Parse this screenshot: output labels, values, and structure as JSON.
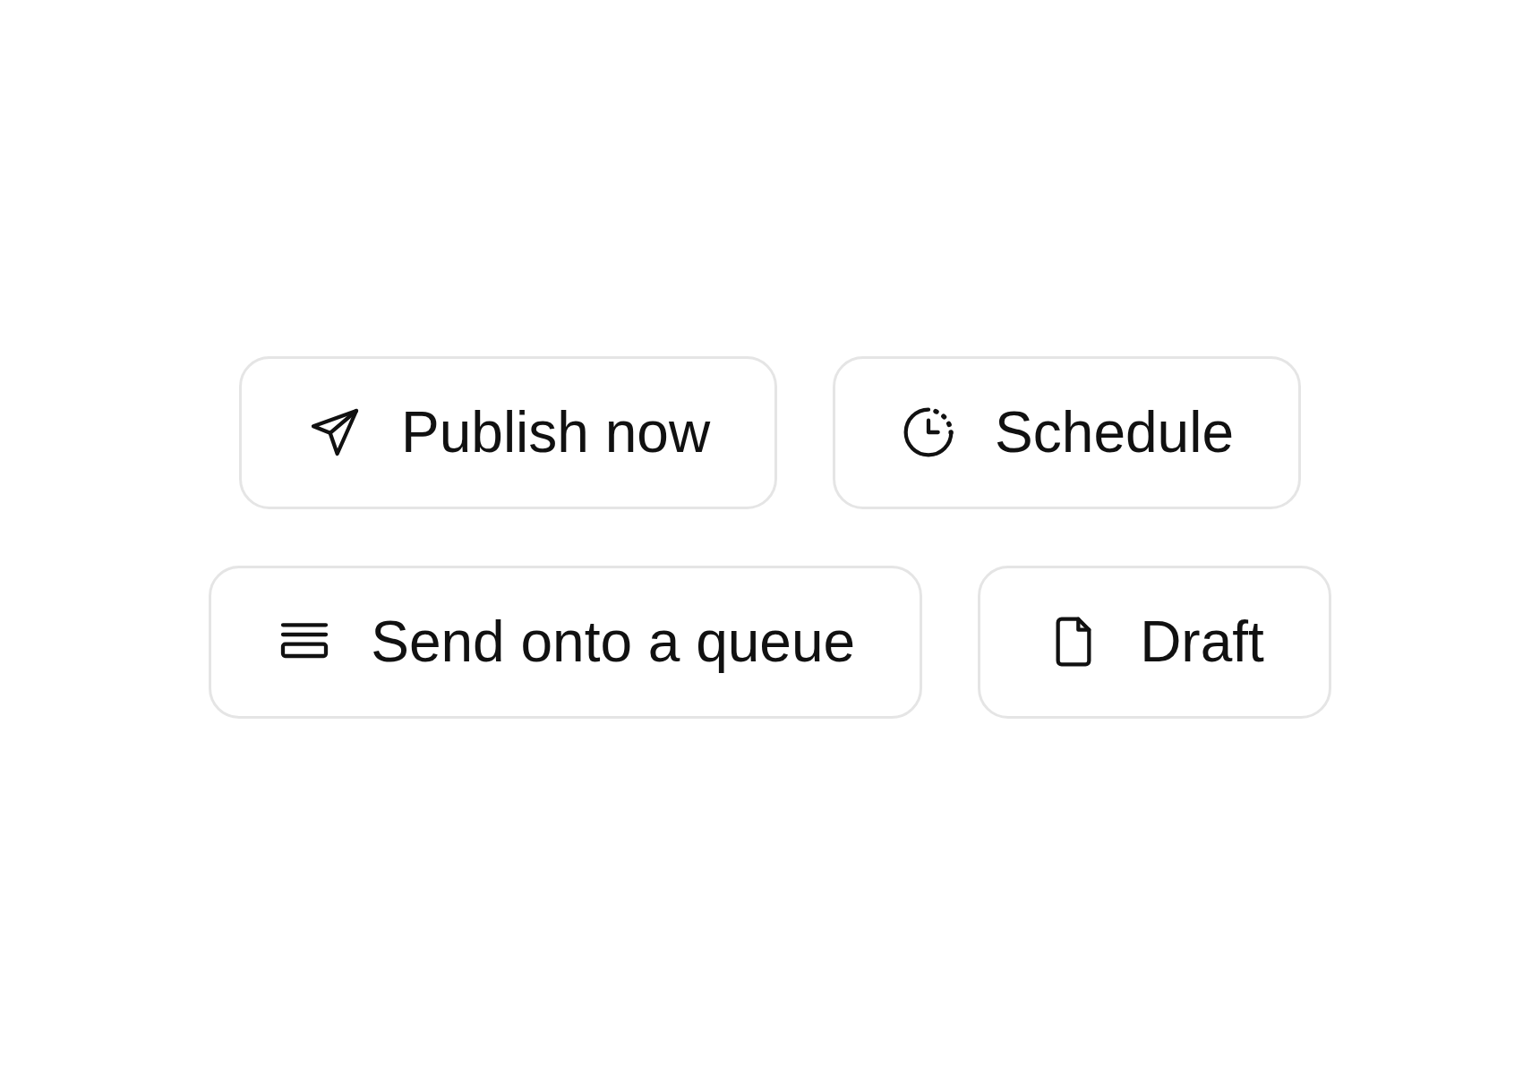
{
  "rows": [
    {
      "buttons": [
        {
          "label": "Publish now",
          "kind": "send"
        },
        {
          "label": "Schedule",
          "kind": "clock"
        }
      ]
    },
    {
      "buttons": [
        {
          "label": "Send onto a queue",
          "kind": "queue"
        },
        {
          "label": "Draft",
          "kind": "file"
        }
      ]
    }
  ]
}
